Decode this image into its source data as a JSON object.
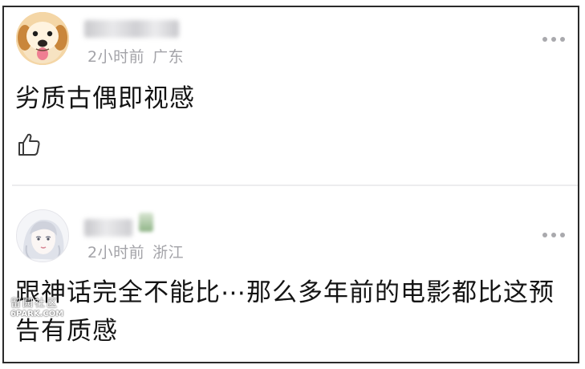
{
  "comments": [
    {
      "avatar": "dog-avatar",
      "username": "",
      "time": "2小时前",
      "location": "广东",
      "text": "劣质古偶即视感",
      "like_icon": "thumbs-up-icon",
      "more_icon": "more-dots-icon"
    },
    {
      "avatar": "girl-sketch-avatar",
      "username": "",
      "time": "2小时前",
      "location": "浙江",
      "text": "跟神话完全不能比⋯那么多年前的电影都比这预告有质感",
      "more_icon": "more-dots-icon"
    }
  ],
  "watermark": {
    "line1": "留园社区",
    "line2": "6PARK.COM"
  },
  "colors": {
    "meta_text": "#a3a3a8",
    "body_text": "#141414",
    "border": "#2b2b2b"
  }
}
